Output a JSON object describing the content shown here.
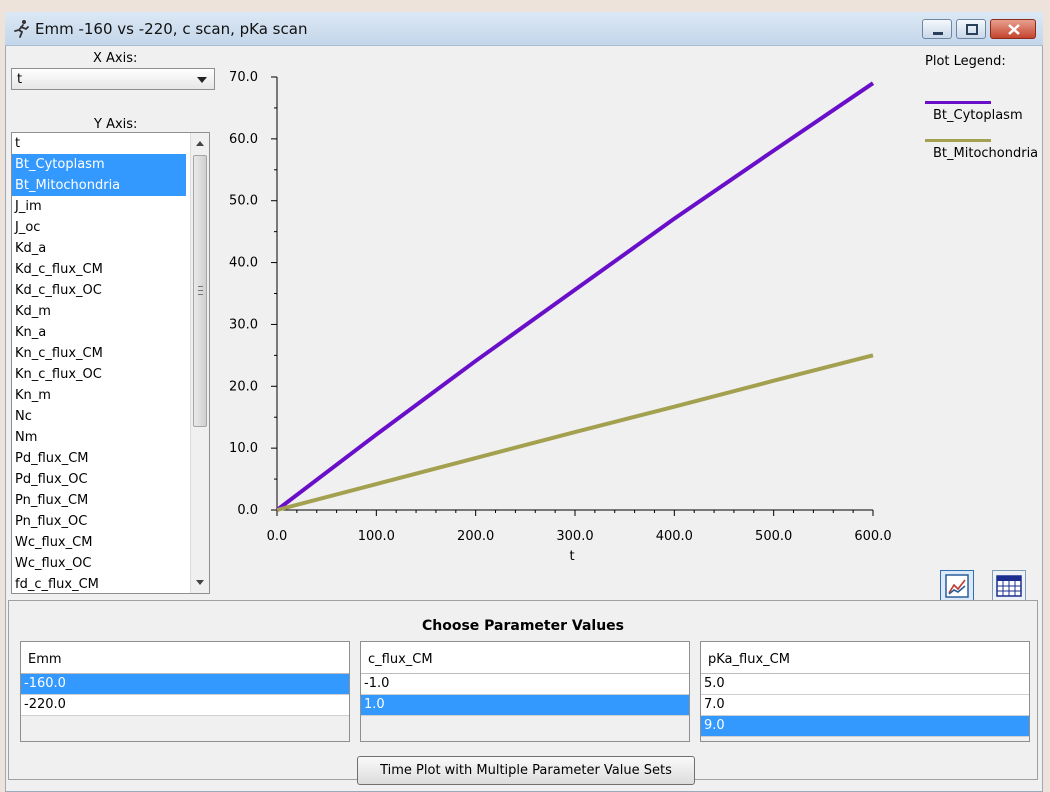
{
  "window": {
    "title": "Emm -160 vs -220, c scan, pKa scan",
    "icon": "running-figure-icon"
  },
  "x_axis": {
    "label": "X Axis:",
    "selected": "t"
  },
  "y_axis": {
    "label": "Y Axis:",
    "items": [
      {
        "label": "t",
        "selected": false
      },
      {
        "label": "Bt_Cytoplasm",
        "selected": true
      },
      {
        "label": "Bt_Mitochondria",
        "selected": true
      },
      {
        "label": "J_im",
        "selected": false
      },
      {
        "label": "J_oc",
        "selected": false
      },
      {
        "label": "Kd_a",
        "selected": false
      },
      {
        "label": "Kd_c_flux_CM",
        "selected": false
      },
      {
        "label": "Kd_c_flux_OC",
        "selected": false
      },
      {
        "label": "Kd_m",
        "selected": false
      },
      {
        "label": "Kn_a",
        "selected": false
      },
      {
        "label": "Kn_c_flux_CM",
        "selected": false
      },
      {
        "label": "Kn_c_flux_OC",
        "selected": false
      },
      {
        "label": "Kn_m",
        "selected": false
      },
      {
        "label": "Nc",
        "selected": false
      },
      {
        "label": "Nm",
        "selected": false
      },
      {
        "label": "Pd_flux_CM",
        "selected": false
      },
      {
        "label": "Pd_flux_OC",
        "selected": false
      },
      {
        "label": "Pn_flux_CM",
        "selected": false
      },
      {
        "label": "Pn_flux_OC",
        "selected": false
      },
      {
        "label": "Wc_flux_CM",
        "selected": false
      },
      {
        "label": "Wc_flux_OC",
        "selected": false
      },
      {
        "label": "fd_c_flux_CM",
        "selected": false
      }
    ]
  },
  "chart_data": {
    "type": "line",
    "xlabel": "t",
    "ylabel": "",
    "xlim": [
      0,
      600
    ],
    "ylim": [
      0,
      70
    ],
    "xticks": [
      "0.0",
      "100.0",
      "200.0",
      "300.0",
      "400.0",
      "500.0",
      "600.0"
    ],
    "yticks": [
      "0.0",
      "10.0",
      "20.0",
      "30.0",
      "40.0",
      "50.0",
      "60.0",
      "70.0"
    ],
    "grid": false,
    "legend_title": "Plot Legend:",
    "legend_position": "right",
    "series": [
      {
        "name": "Bt_Cytoplasm",
        "color": "#6a0fc9",
        "x": [
          0,
          100,
          200,
          300,
          400,
          500,
          600
        ],
        "y": [
          0,
          12.2,
          24.1,
          35.6,
          47.1,
          58.1,
          69.0
        ]
      },
      {
        "name": "Bt_Mitochondria",
        "color": "#a3a050",
        "x": [
          0,
          100,
          200,
          300,
          400,
          500,
          600
        ],
        "y": [
          0,
          4.2,
          8.4,
          12.6,
          16.7,
          20.9,
          25.0
        ]
      }
    ]
  },
  "view_buttons": {
    "plot": "plot-view-icon",
    "table": "table-view-icon"
  },
  "parameters": {
    "title": "Choose Parameter Values",
    "tables": [
      {
        "header": "Emm",
        "rows": [
          {
            "value": "-160.0",
            "selected": true
          },
          {
            "value": "-220.0",
            "selected": false
          }
        ]
      },
      {
        "header": "c_flux_CM",
        "rows": [
          {
            "value": "-1.0",
            "selected": false
          },
          {
            "value": "1.0",
            "selected": true
          }
        ]
      },
      {
        "header": "pKa_flux_CM",
        "rows": [
          {
            "value": "5.0",
            "selected": false
          },
          {
            "value": "7.0",
            "selected": false
          },
          {
            "value": "9.0",
            "selected": true
          }
        ]
      }
    ]
  },
  "run_button": {
    "label": "Time Plot with Multiple Parameter Value Sets"
  }
}
